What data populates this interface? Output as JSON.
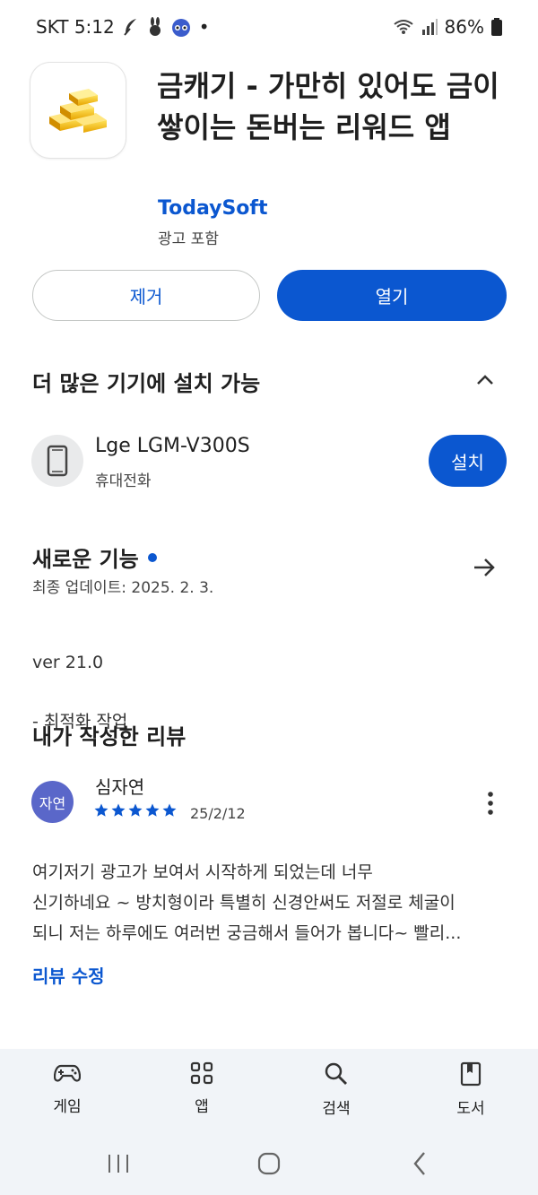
{
  "status_bar": {
    "carrier_time": "SKT 5:12",
    "battery": "86%",
    "status_dot": "•",
    "icons": [
      "feather-icon",
      "rabbit-icon",
      "raccoon-icon",
      "wifi-icon",
      "signal-icon",
      "battery-icon"
    ]
  },
  "app": {
    "title": "금캐기 - 가만히 있어도 금이 쌓이는 돈버는 리워드 앱",
    "developer": "TodaySoft",
    "ads_label": "광고 포함",
    "icon": "gold-bars-icon"
  },
  "actions": {
    "remove_label": "제거",
    "open_label": "열기"
  },
  "more_devices": {
    "title": "더 많은 기기에 설치 가능",
    "device_name": "Lge LGM-V300S",
    "device_type": "휴대전화",
    "install_label": "설치"
  },
  "whats_new": {
    "title": "새로운 기능",
    "updated": "최종 업데이트: 2025. 2. 3.",
    "notes_line1": "ver 21.0",
    "notes_line2": "- 최적화 작업"
  },
  "my_review": {
    "title": "내가 작성한 리뷰",
    "avatar_text": "자연",
    "reviewer": "심자연",
    "rating": 5,
    "date": "25/2/12",
    "text_line1": "여기저기 광고가 보여서 시작하게 되었는데 너무",
    "text_line2": "신기하네요 ~ 방치형이라 특별히 신경안써도 저절로 체굴이",
    "text_line3": "되니 저는 하루에도 여러번 궁금해서 들어가 봅니다~ 빨리...",
    "edit_label": "리뷰 수정"
  },
  "bottom_nav": {
    "games": "게임",
    "apps": "앱",
    "search": "검색",
    "books": "도서"
  },
  "colors": {
    "accent": "#0b57d0",
    "nav_bg": "#f1f4f8",
    "avatar_bg": "#5a67c9"
  }
}
